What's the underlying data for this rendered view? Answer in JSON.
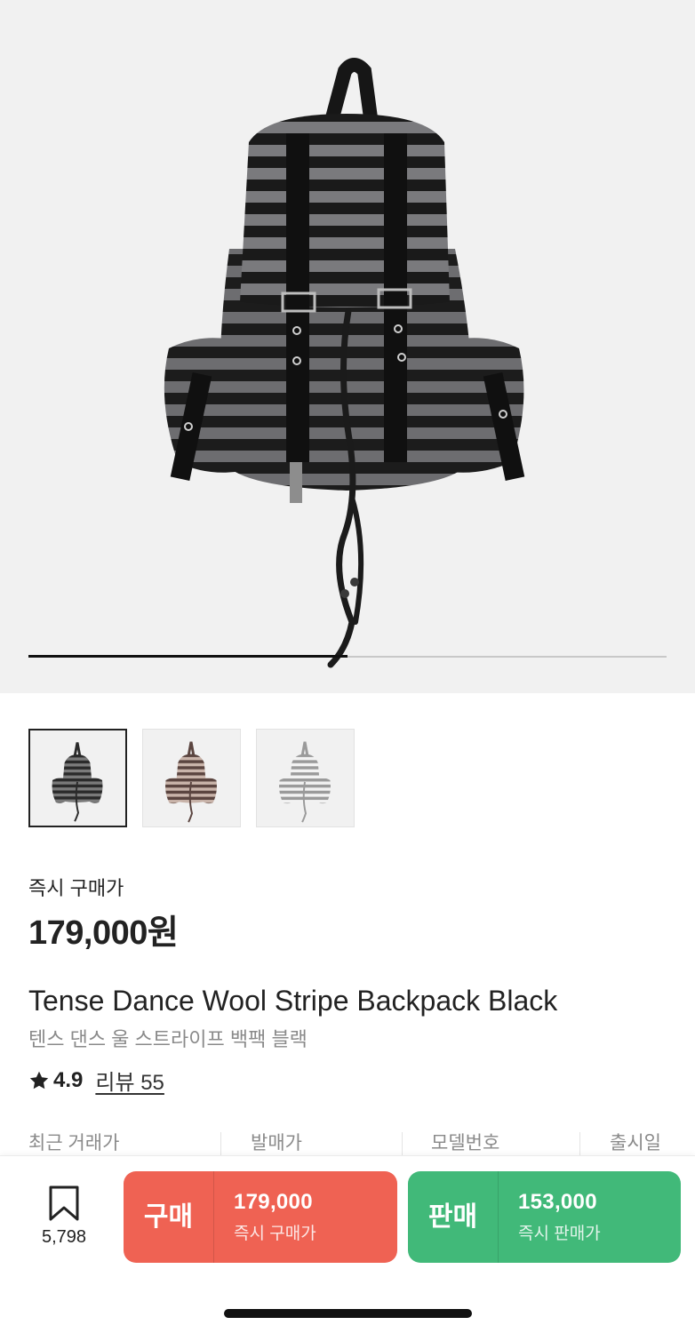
{
  "product": {
    "image_icon": "striped-backpack-image",
    "gallery_progress": 0.5,
    "thumbnails": [
      {
        "icon": "backpack-black-thumb",
        "stripe_a": "#2a2a2a",
        "stripe_b": "#7a7a7a",
        "active": true
      },
      {
        "icon": "backpack-brown-thumb",
        "stripe_a": "#5b4540",
        "stripe_b": "#c9b4aa",
        "active": false
      },
      {
        "icon": "backpack-white-thumb",
        "stripe_a": "#9a9a9a",
        "stripe_b": "#f2f2f2",
        "active": false
      }
    ],
    "price_label": "즉시 구매가",
    "price": "179,000원",
    "title_en": "Tense Dance Wool Stripe Backpack Black",
    "title_ko": "텐스 댄스 울 스트라이프 백팩 블랙",
    "rating": "4.9",
    "reviews": "리뷰 55"
  },
  "info": {
    "recent_trade": "최근 거래가",
    "release_price": "발매가",
    "model_number": "모델번호",
    "release_date": "출시일"
  },
  "bottom": {
    "wish_count": "5,798",
    "buy_label": "구매",
    "buy_price": "179,000",
    "buy_caption": "즉시 구매가",
    "sell_label": "판매",
    "sell_price": "153,000",
    "sell_caption": "즉시 판매가"
  },
  "colors": {
    "buy": "#ef6253",
    "sell": "#41b979",
    "hero_bg": "#f1f1f1"
  }
}
